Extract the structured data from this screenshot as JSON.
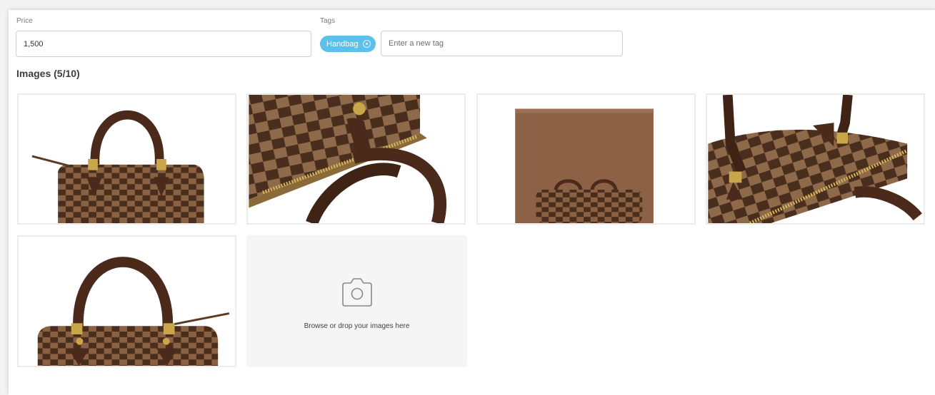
{
  "price": {
    "label": "Price",
    "value": "1,500"
  },
  "tags": {
    "label": "Tags",
    "items": [
      {
        "label": "Handbag",
        "remove_icon": "remove-circle-icon"
      }
    ],
    "input_placeholder": "Enter a new tag"
  },
  "images": {
    "heading": "Images (5/10)",
    "thumbnails": [
      {
        "subject": "handbag-front"
      },
      {
        "subject": "handbag-closeup-zipper"
      },
      {
        "subject": "box-with-handbag"
      },
      {
        "subject": "handbag-top-handles"
      },
      {
        "subject": "handbag-front-closeup"
      }
    ],
    "dropzone": {
      "icon": "camera-icon",
      "text": "Browse or drop your images here"
    }
  },
  "colors": {
    "tag_chip": "#5cc0ea",
    "damier_dark": "#4a2e1d",
    "damier_light": "#8a6142",
    "handle": "#4b2a1c",
    "hardware": "#c9a64a"
  }
}
